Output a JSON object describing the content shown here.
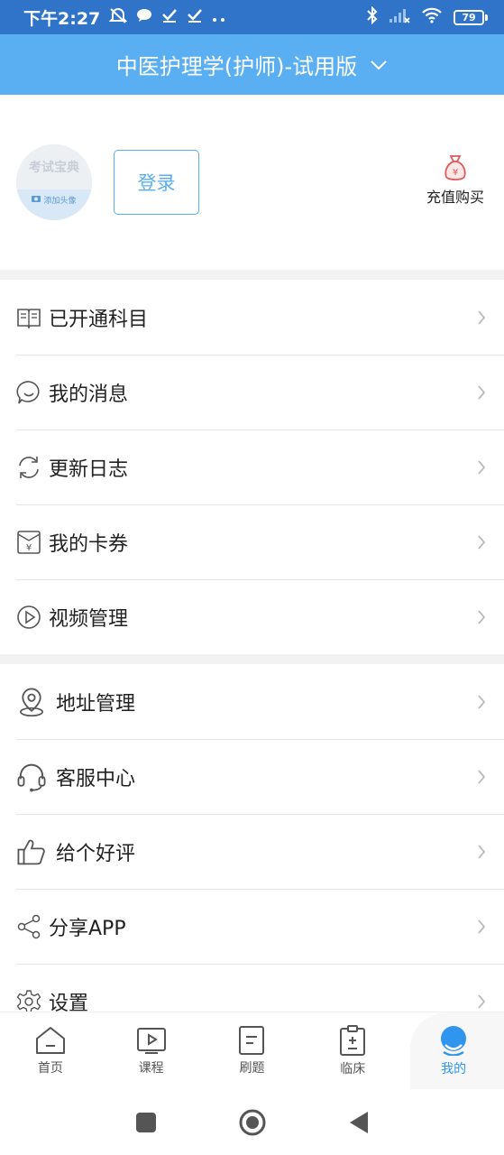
{
  "status_bar": {
    "time": "下午2:27",
    "battery": "79"
  },
  "header": {
    "title": "中医护理学(护师)-试用版"
  },
  "profile": {
    "avatar_text": "考试宝典",
    "avatar_sub": "添加头像",
    "login_label": "登录",
    "recharge_label": "充值购买"
  },
  "menu_group_1": [
    {
      "label": "已开通科目",
      "icon": "book-icon"
    },
    {
      "label": "我的消息",
      "icon": "chat-bubble-icon"
    },
    {
      "label": "更新日志",
      "icon": "refresh-icon"
    },
    {
      "label": "我的卡券",
      "icon": "coupon-icon"
    },
    {
      "label": "视频管理",
      "icon": "play-circle-icon"
    }
  ],
  "menu_group_2": [
    {
      "label": "地址管理",
      "icon": "location-pin-icon"
    },
    {
      "label": "客服中心",
      "icon": "headset-icon"
    },
    {
      "label": "给个好评",
      "icon": "thumbs-up-icon"
    },
    {
      "label": "分享APP",
      "icon": "share-icon"
    },
    {
      "label": "设置",
      "icon": "gear-icon"
    }
  ],
  "bottom_nav": [
    {
      "label": "首页",
      "icon": "home-icon"
    },
    {
      "label": "课程",
      "icon": "video-icon"
    },
    {
      "label": "刷题",
      "icon": "paper-icon"
    },
    {
      "label": "临床",
      "icon": "clipboard-icon"
    },
    {
      "label": "我的",
      "icon": "smiley-icon",
      "active": true
    }
  ],
  "colors": {
    "accent": "#5aaff3",
    "status_bar": "#2f74c9",
    "active_tab": "#2f95ee"
  }
}
